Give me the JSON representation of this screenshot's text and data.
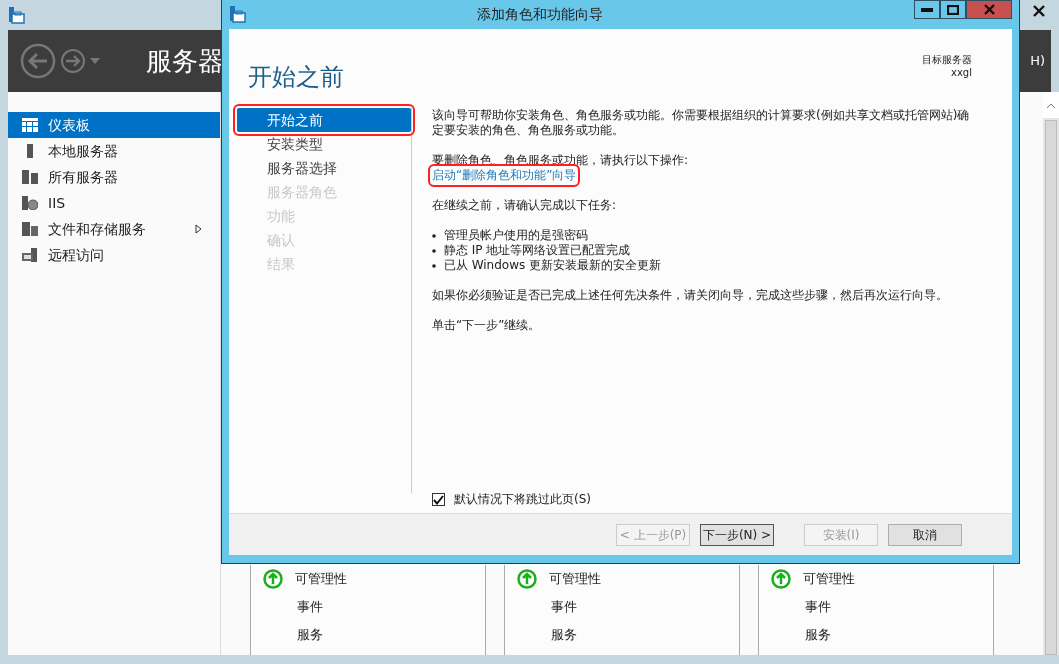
{
  "server_manager": {
    "header_title": "服务器",
    "menu_fragment": "H)",
    "nav": [
      {
        "label": "仪表板",
        "kind": "grid",
        "selected": true,
        "expandable": false
      },
      {
        "label": "本地服务器",
        "kind": "server",
        "selected": false,
        "expandable": false
      },
      {
        "label": "所有服务器",
        "kind": "servers",
        "selected": false,
        "expandable": false
      },
      {
        "label": "IIS",
        "kind": "iis",
        "selected": false,
        "expandable": false
      },
      {
        "label": "文件和存储服务",
        "kind": "files",
        "selected": false,
        "expandable": true
      },
      {
        "label": "远程访问",
        "kind": "remote",
        "selected": false,
        "expandable": false
      }
    ],
    "tiles": [
      {
        "rows": [
          {
            "label": "可管理性",
            "kind": "status"
          },
          {
            "label": "事件",
            "kind": "link"
          },
          {
            "label": "服务",
            "kind": "link"
          }
        ]
      },
      {
        "rows": [
          {
            "label": "可管理性",
            "kind": "status"
          },
          {
            "label": "事件",
            "kind": "link"
          },
          {
            "label": "服务",
            "kind": "link"
          }
        ]
      },
      {
        "rows": [
          {
            "label": "可管理性",
            "kind": "status"
          },
          {
            "label": "事件",
            "kind": "link"
          },
          {
            "label": "服务",
            "kind": "link"
          }
        ]
      }
    ]
  },
  "wizard": {
    "title": "添加角色和功能向导",
    "heading": "开始之前",
    "target_label": "目标服务器",
    "target_value": "xxgl",
    "steps": [
      {
        "label": "开始之前",
        "selected": true,
        "disabled": false,
        "annotated": true
      },
      {
        "label": "安装类型",
        "selected": false,
        "disabled": false,
        "annotated": false
      },
      {
        "label": "服务器选择",
        "selected": false,
        "disabled": false,
        "annotated": false
      },
      {
        "label": "服务器角色",
        "selected": false,
        "disabled": true,
        "annotated": false
      },
      {
        "label": "功能",
        "selected": false,
        "disabled": true,
        "annotated": false
      },
      {
        "label": "确认",
        "selected": false,
        "disabled": true,
        "annotated": false
      },
      {
        "label": "结果",
        "selected": false,
        "disabled": true,
        "annotated": false
      }
    ],
    "intro": "该向导可帮助你安装角色、角色服务或功能。你需要根据组织的计算要求(例如共享文档或托管网站)确定要安装的角色、角色服务或功能。",
    "remove_intro": "要删除角色、角色服务或功能，请执行以下操作:",
    "remove_link": {
      "label": "启动“删除角色和功能”向导",
      "annotated": true
    },
    "before_label": "在继续之前，请确认完成以下任务:",
    "bullets": [
      "管理员帐户使用的是强密码",
      "静态 IP 地址等网络设置已配置完成",
      "已从 Windows 更新安装最新的安全更新"
    ],
    "verify": "如果你必须验证是否已完成上述任何先决条件，请关闭向导，完成这些步骤，然后再次运行向导。",
    "continue": "单击“下一步”继续。",
    "skip_checkbox": {
      "label": "默认情况下将跳过此页(S)",
      "checked": true
    },
    "buttons": [
      {
        "label": "< 上一步(P)",
        "disabled": true,
        "focused": false
      },
      {
        "label": "下一步(N) >",
        "disabled": false,
        "focused": true
      },
      {
        "label": "安装(I)",
        "disabled": true,
        "focused": false
      },
      {
        "label": "取消",
        "disabled": false,
        "focused": false
      }
    ]
  }
}
